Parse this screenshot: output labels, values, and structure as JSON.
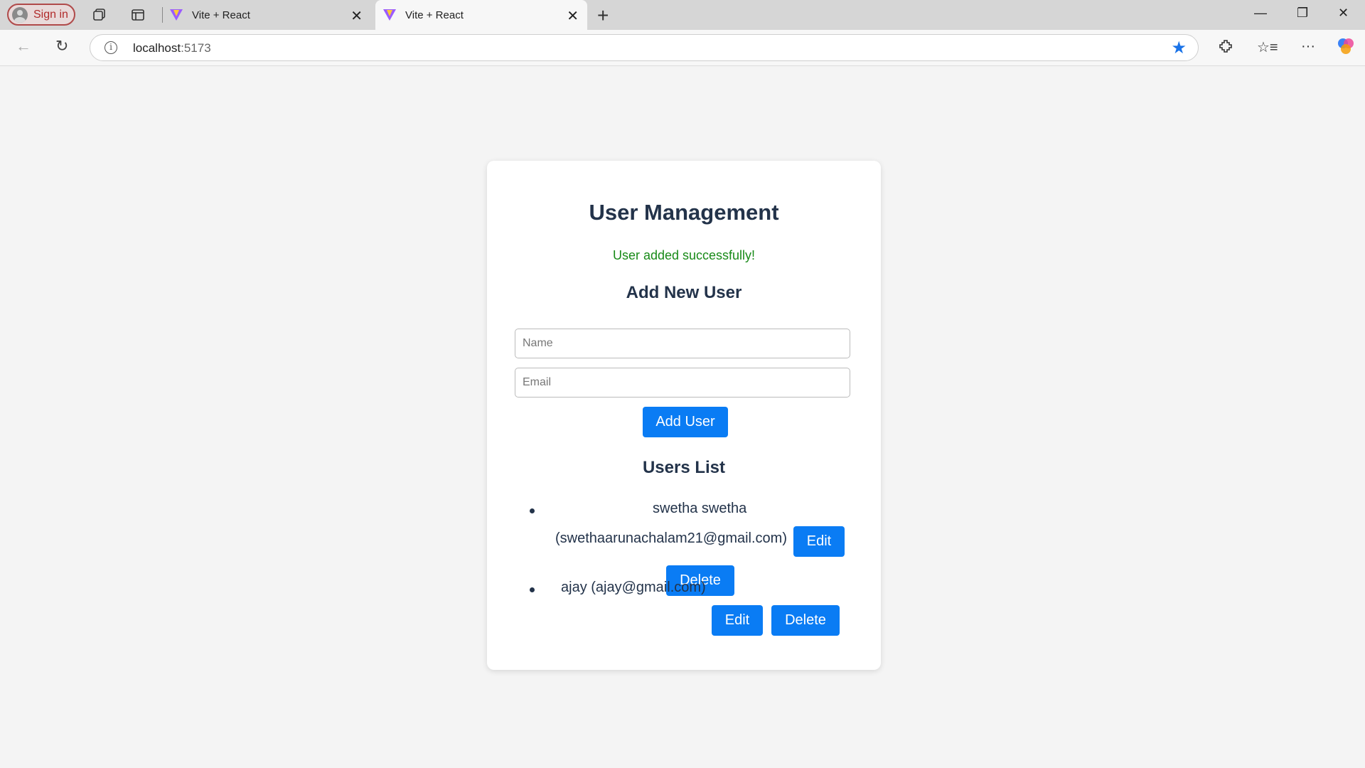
{
  "browser": {
    "signin_label": "Sign in",
    "tabs": [
      {
        "title": "Vite + React",
        "active": false
      },
      {
        "title": "Vite + React",
        "active": true
      }
    ],
    "url_host": "localhost",
    "url_port": ":5173"
  },
  "app": {
    "title": "User Management",
    "status_message": "User added successfully!",
    "add_section_title": "Add New User",
    "name_placeholder": "Name",
    "email_placeholder": "Email",
    "add_button_label": "Add User",
    "list_title": "Users List",
    "edit_label": "Edit",
    "delete_label": "Delete",
    "users": [
      {
        "name": "swetha swetha",
        "email": "(swethaarunachalam21@gmail.com)"
      },
      {
        "display": "ajay (ajay@gmail.com)"
      }
    ]
  },
  "colors": {
    "accent": "#0a7cf4",
    "success": "#188a18",
    "heading": "#23334a",
    "star": "#1a73e8"
  }
}
